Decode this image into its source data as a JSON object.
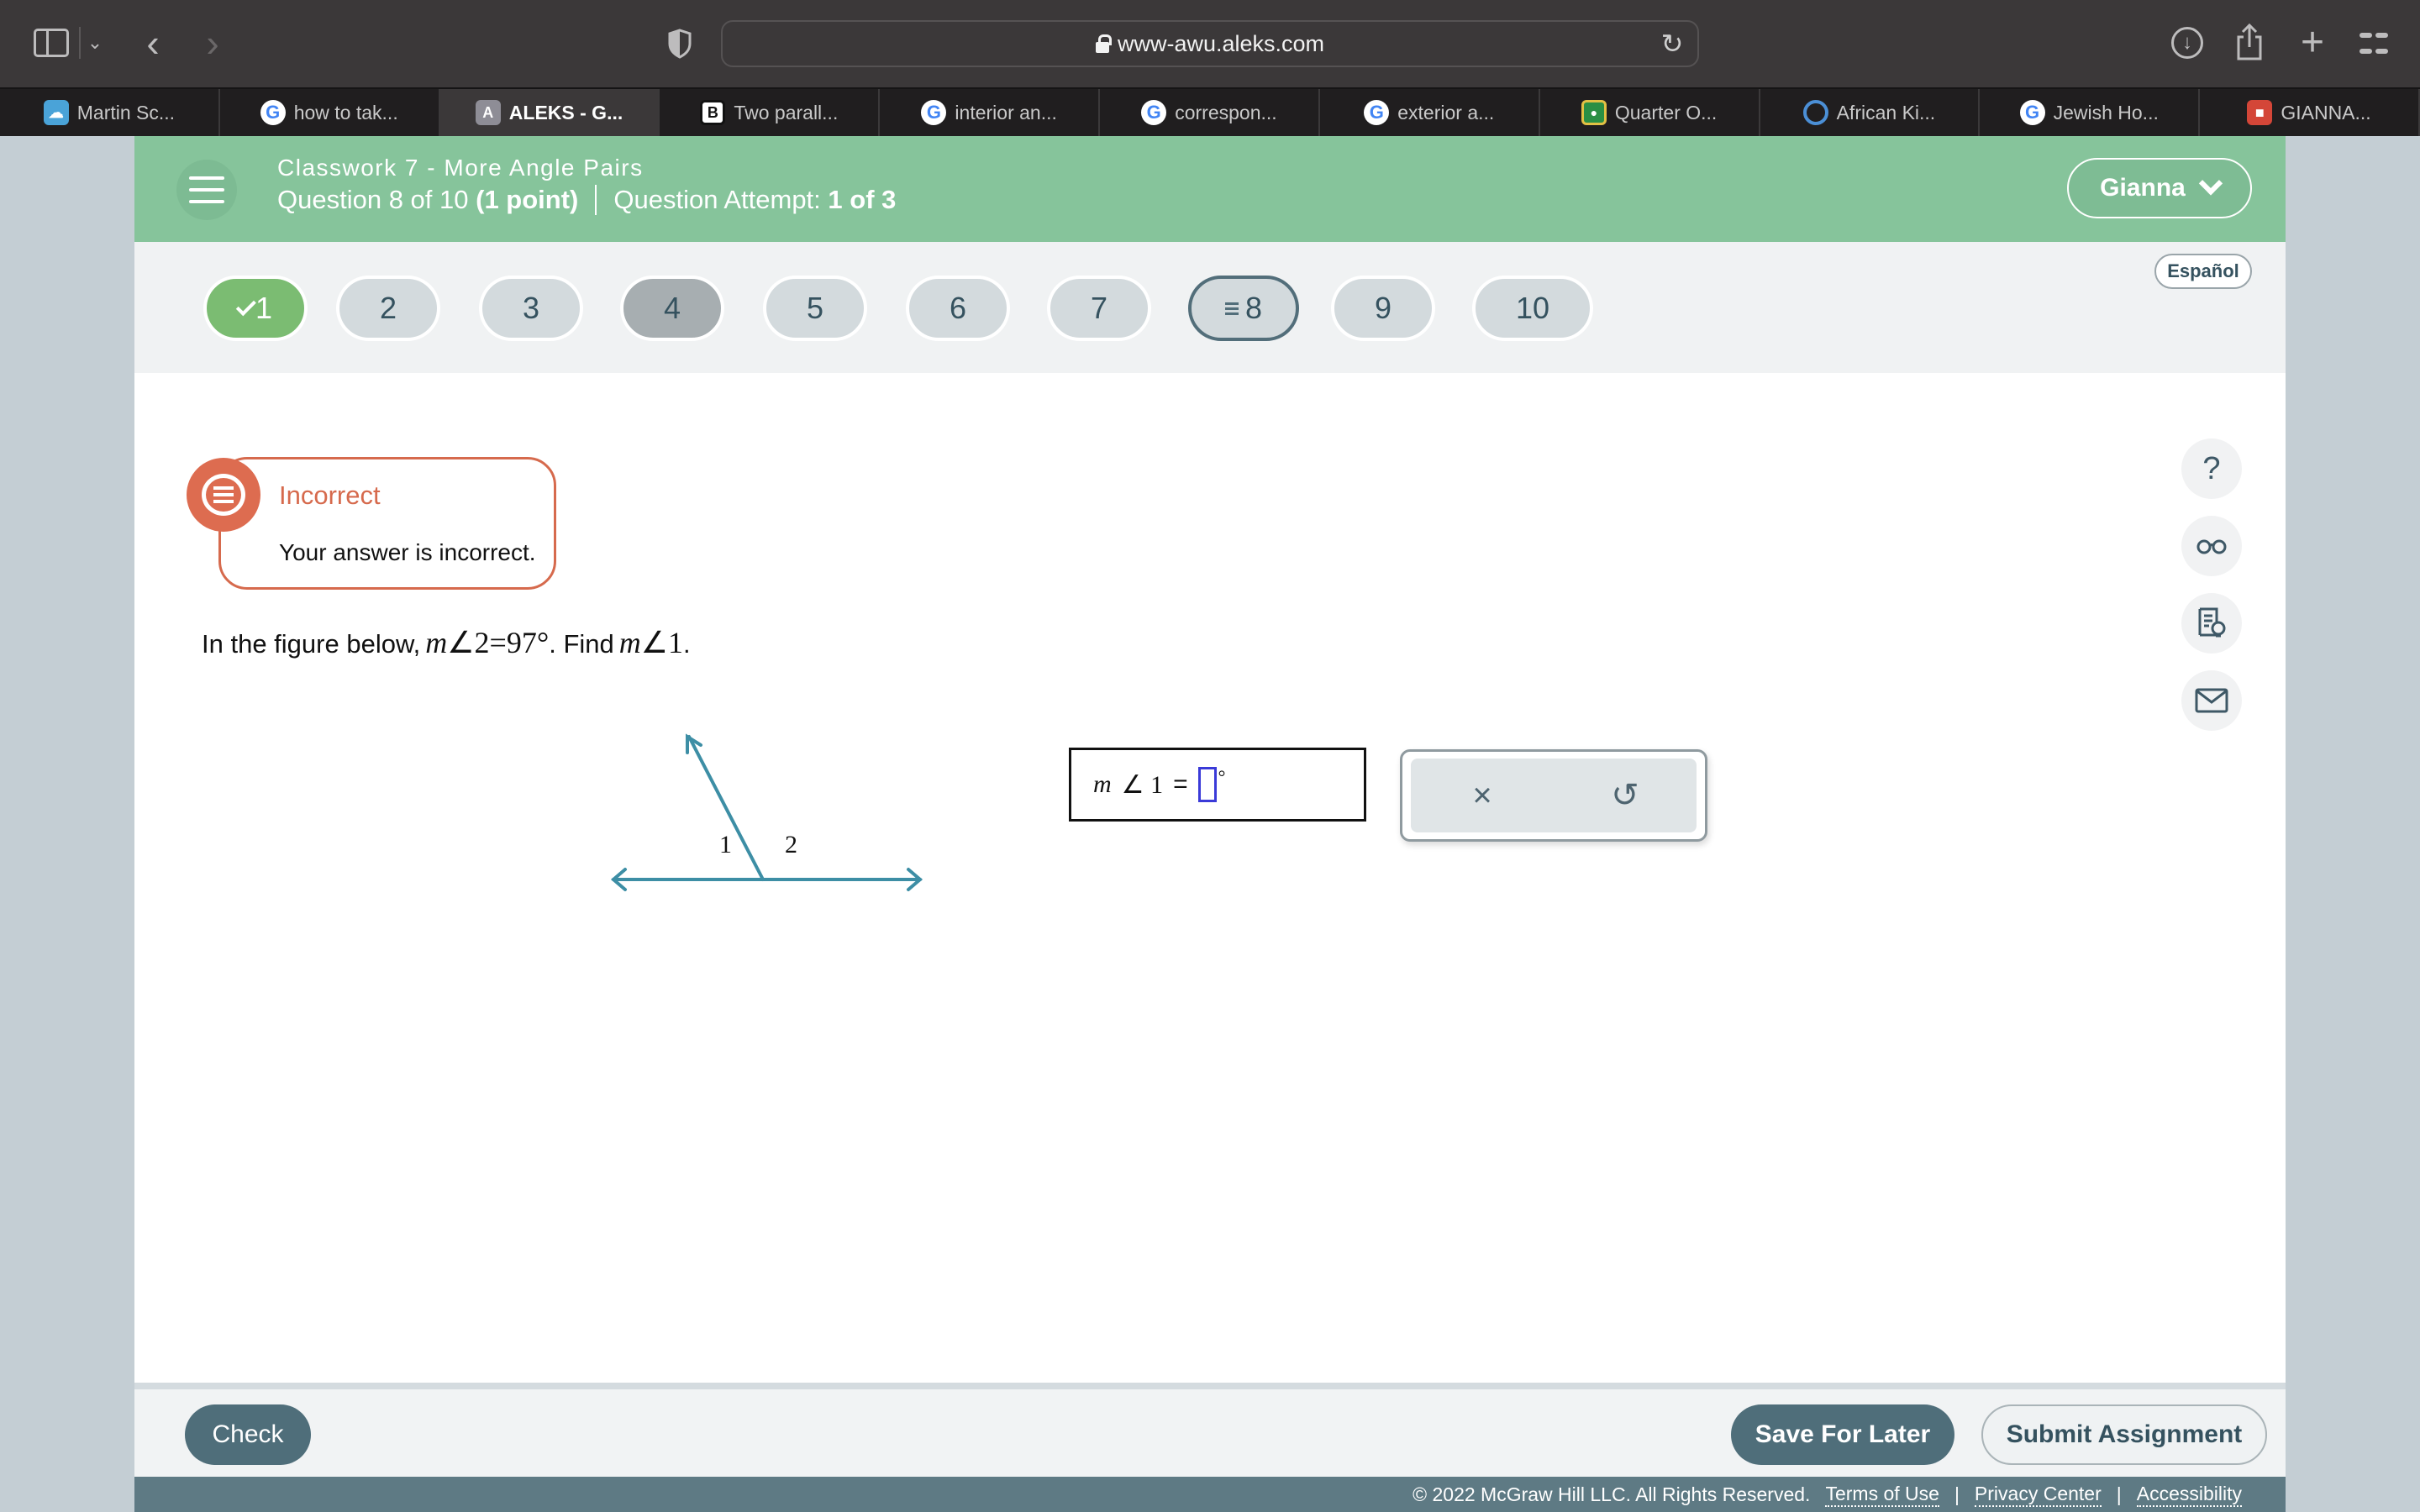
{
  "browser": {
    "url": "www-awu.aleks.com",
    "tabs": [
      {
        "label": "Martin Sc...",
        "favicon": "cloud-icon",
        "active": false
      },
      {
        "label": "how to tak...",
        "favicon": "google-icon",
        "active": false
      },
      {
        "label": "ALEKS - G...",
        "favicon": "aleks-icon",
        "active": true
      },
      {
        "label": "Two parall...",
        "favicon": "brainly-icon",
        "active": false
      },
      {
        "label": "interior an...",
        "favicon": "google-icon",
        "active": false
      },
      {
        "label": "correspon...",
        "favicon": "google-icon",
        "active": false
      },
      {
        "label": "exterior a...",
        "favicon": "google-icon",
        "active": false
      },
      {
        "label": "Quarter O...",
        "favicon": "classroom-icon",
        "active": false
      },
      {
        "label": "African Ki...",
        "favicon": "ring-icon",
        "active": false
      },
      {
        "label": "Jewish Ho...",
        "favicon": "google-icon",
        "active": false
      },
      {
        "label": "GIANNA...",
        "favicon": "slides-icon",
        "active": false
      }
    ]
  },
  "header": {
    "title": "Classwork 7 - More Angle Pairs",
    "question_prefix": "Question 8 of 10",
    "points": "(1 point)",
    "attempt_label": "Question Attempt:",
    "attempt_value": "1 of 3",
    "user_name": "Gianna",
    "language_button": "Español",
    "accent_color": "#86c49b"
  },
  "question_nav": [
    {
      "label": "1",
      "state": "done"
    },
    {
      "label": "2",
      "state": "unvisited"
    },
    {
      "label": "3",
      "state": "unvisited"
    },
    {
      "label": "4",
      "state": "visited"
    },
    {
      "label": "5",
      "state": "unvisited"
    },
    {
      "label": "6",
      "state": "unvisited"
    },
    {
      "label": "7",
      "state": "unvisited"
    },
    {
      "label": "8",
      "state": "current"
    },
    {
      "label": "9",
      "state": "unvisited"
    },
    {
      "label": "10",
      "state": "unvisited"
    }
  ],
  "feedback": {
    "title": "Incorrect",
    "message": "Your answer is incorrect.",
    "color": "#d66a4d"
  },
  "question": {
    "lead": "In the figure below,",
    "given_var": "m",
    "given_angle": "∠2",
    "given_eq": "=97°",
    "find_label": ". Find",
    "find_var": "m",
    "find_angle": "∠1",
    "end": "."
  },
  "figure": {
    "angle_labels": [
      "1",
      "2"
    ],
    "line_color": "#3d8ea5"
  },
  "answer": {
    "var": "m",
    "angle": "∠ 1",
    "equals": "=",
    "value": "",
    "unit": "°"
  },
  "tools": {
    "clear_icon": "×",
    "undo_icon": "↺"
  },
  "side_tools": [
    {
      "name": "help-icon",
      "glyph": "?"
    },
    {
      "name": "glasses-icon",
      "glyph": "oo"
    },
    {
      "name": "hint-document-icon",
      "glyph": "≡"
    },
    {
      "name": "mail-icon",
      "glyph": "✉"
    }
  ],
  "footer": {
    "check": "Check",
    "save": "Save For Later",
    "submit": "Submit Assignment",
    "copyright": "© 2022 McGraw Hill LLC. All Rights Reserved.",
    "links": [
      "Terms of Use",
      "Privacy Center",
      "Accessibility"
    ],
    "separator": "|"
  }
}
